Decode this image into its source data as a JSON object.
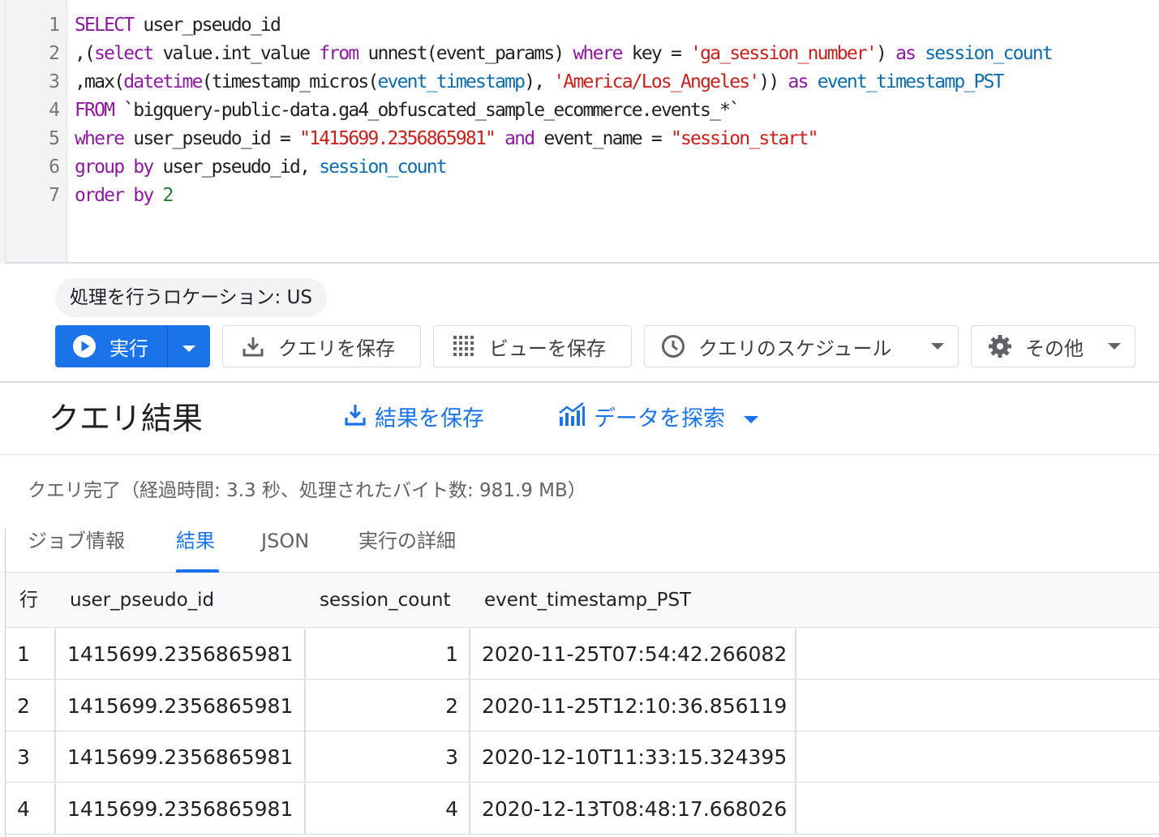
{
  "editor": {
    "lines": [
      [
        {
          "t": "SELECT",
          "c": "kw"
        },
        {
          "t": " user_pseudo_id",
          "c": "pl"
        }
      ],
      [
        {
          "t": ",(",
          "c": "pl"
        },
        {
          "t": "select",
          "c": "kw"
        },
        {
          "t": " value.int_value ",
          "c": "pl"
        },
        {
          "t": "from",
          "c": "kw"
        },
        {
          "t": " unnest(event_params) ",
          "c": "pl"
        },
        {
          "t": "where",
          "c": "kw"
        },
        {
          "t": " key = ",
          "c": "pl"
        },
        {
          "t": "'ga_session_number'",
          "c": "str"
        },
        {
          "t": ") ",
          "c": "pl"
        },
        {
          "t": "as",
          "c": "kw"
        },
        {
          "t": " ",
          "c": "pl"
        },
        {
          "t": "session_count",
          "c": "id"
        }
      ],
      [
        {
          "t": ",max(",
          "c": "pl"
        },
        {
          "t": "datetime",
          "c": "kw"
        },
        {
          "t": "(timestamp_micros(",
          "c": "pl"
        },
        {
          "t": "event_timestamp",
          "c": "id"
        },
        {
          "t": "), ",
          "c": "pl"
        },
        {
          "t": "'America/Los_Angeles'",
          "c": "str"
        },
        {
          "t": ")) ",
          "c": "pl"
        },
        {
          "t": "as",
          "c": "kw"
        },
        {
          "t": " ",
          "c": "pl"
        },
        {
          "t": "event_timestamp_PST",
          "c": "id"
        }
      ],
      [
        {
          "t": "FROM",
          "c": "kw"
        },
        {
          "t": " `bigquery-public-data.ga4_obfuscated_sample_ecommerce.events_*`",
          "c": "pl"
        }
      ],
      [
        {
          "t": "where",
          "c": "kw"
        },
        {
          "t": " user_pseudo_id = ",
          "c": "pl"
        },
        {
          "t": "\"1415699.2356865981\"",
          "c": "str"
        },
        {
          "t": " ",
          "c": "pl"
        },
        {
          "t": "and",
          "c": "kw"
        },
        {
          "t": " event_name = ",
          "c": "pl"
        },
        {
          "t": "\"session_start\"",
          "c": "str"
        }
      ],
      [
        {
          "t": "group by",
          "c": "kw"
        },
        {
          "t": " user_pseudo_id, ",
          "c": "pl"
        },
        {
          "t": "session_count",
          "c": "id"
        }
      ],
      [
        {
          "t": "order by",
          "c": "kw"
        },
        {
          "t": " ",
          "c": "pl"
        },
        {
          "t": "2",
          "c": "num"
        }
      ]
    ],
    "line_numbers": [
      "1",
      "2",
      "3",
      "4",
      "5",
      "6",
      "7"
    ]
  },
  "toolbar": {
    "location_label": "処理を行うロケーション: US",
    "run_label": "実行",
    "save_query_label": "クエリを保存",
    "save_view_label": "ビューを保存",
    "schedule_label": "クエリのスケジュール",
    "more_label": "その他"
  },
  "results": {
    "title": "クエリ結果",
    "save_results_label": "結果を保存",
    "explore_data_label": "データを探索",
    "status": "クエリ完了（経過時間: 3.3 秒、処理されたバイト数: 981.9 MB）",
    "tabs": [
      "ジョブ情報",
      "結果",
      "JSON",
      "実行の詳細"
    ],
    "active_tab": 1
  },
  "table": {
    "headers": [
      "行",
      "user_pseudo_id",
      "session_count",
      "event_timestamp_PST"
    ],
    "rows": [
      [
        "1",
        "1415699.2356865981",
        "1",
        "2020-11-25T07:54:42.266082"
      ],
      [
        "2",
        "1415699.2356865981",
        "2",
        "2020-11-25T12:10:36.856119"
      ],
      [
        "3",
        "1415699.2356865981",
        "3",
        "2020-12-10T11:33:15.324395"
      ],
      [
        "4",
        "1415699.2356865981",
        "4",
        "2020-12-13T08:48:17.668026"
      ]
    ]
  },
  "colors": {
    "accent": "#1a73e8",
    "keyword": "#8b1a9c",
    "identifier": "#0d6ca8",
    "string": "#c5221f"
  },
  "icons": {
    "run": "play-circle-icon",
    "save_query": "download-icon",
    "save_view": "grid-dots-icon",
    "schedule": "clock-icon",
    "more": "gear-icon",
    "save_results": "download-icon",
    "explore_data": "chart-icon"
  }
}
